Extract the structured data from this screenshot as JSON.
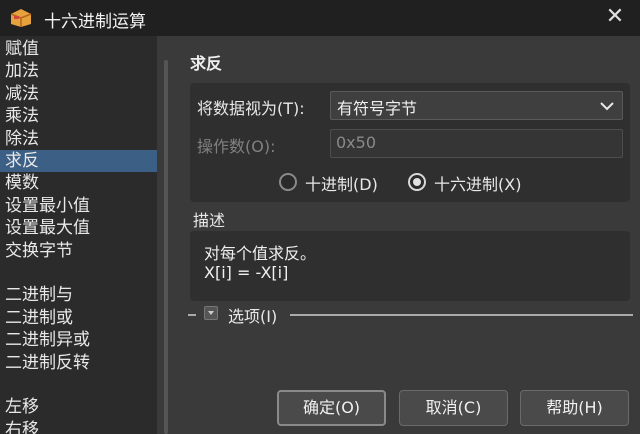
{
  "window": {
    "title": "十六进制运算",
    "close_icon": "close-icon"
  },
  "sidebar": {
    "items": [
      {
        "label": "赋值",
        "selected": false
      },
      {
        "label": "加法",
        "selected": false
      },
      {
        "label": "减法",
        "selected": false
      },
      {
        "label": "乘法",
        "selected": false
      },
      {
        "label": "除法",
        "selected": false
      },
      {
        "label": "求反",
        "selected": true
      },
      {
        "label": "模数",
        "selected": false
      },
      {
        "label": "设置最小值",
        "selected": false
      },
      {
        "label": "设置最大值",
        "selected": false
      },
      {
        "label": "交换字节",
        "selected": false
      },
      {
        "label": "",
        "selected": false
      },
      {
        "label": "二进制与",
        "selected": false
      },
      {
        "label": "二进制或",
        "selected": false
      },
      {
        "label": "二进制异或",
        "selected": false
      },
      {
        "label": "二进制反转",
        "selected": false
      },
      {
        "label": "",
        "selected": false
      },
      {
        "label": "左移",
        "selected": false
      },
      {
        "label": "右移",
        "selected": false
      }
    ]
  },
  "main": {
    "section_title": "求反",
    "view_as_label": "将数据视为(T):",
    "view_as_value": "有符号字节",
    "operand_label": "操作数(O):",
    "operand_value": "0x50",
    "radio_decimal": "十进制(D)",
    "radio_hex": "十六进制(X)",
    "radio_selected": "hex",
    "description_label": "描述",
    "description_lines": [
      "对每个值求反。",
      "X[i] = -X[i]"
    ],
    "options_label": "选项(I)"
  },
  "buttons": {
    "ok": "确定(O)",
    "cancel": "取消(C)",
    "help": "帮助(H)"
  },
  "colors": {
    "selection": "#3c5f86",
    "background": "#3a3a3a",
    "sidebar": "#2b2b2b",
    "titlebar": "#202020"
  }
}
